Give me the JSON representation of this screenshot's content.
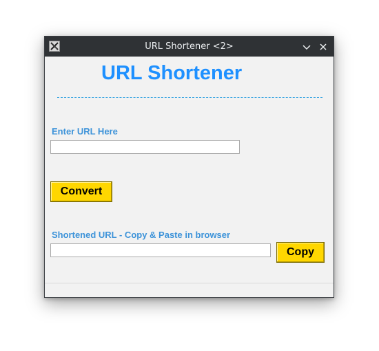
{
  "window": {
    "title": "URL Shortener <2>",
    "app_icon": "x11-app-icon",
    "minimize_icon": "chevron-down-icon",
    "close_icon": "close-icon"
  },
  "main": {
    "heading": "URL Shortener",
    "url_label": "Enter URL Here",
    "url_value": "",
    "convert_label": "Convert",
    "short_label": "Shortened URL - Copy & Paste in browser",
    "short_value": "",
    "copy_label": "Copy"
  },
  "colors": {
    "heading": "#1e90ff",
    "label": "#3d93d9",
    "button": "#ffd700",
    "titlebar": "#2f3235",
    "background": "#f2f2f2"
  }
}
